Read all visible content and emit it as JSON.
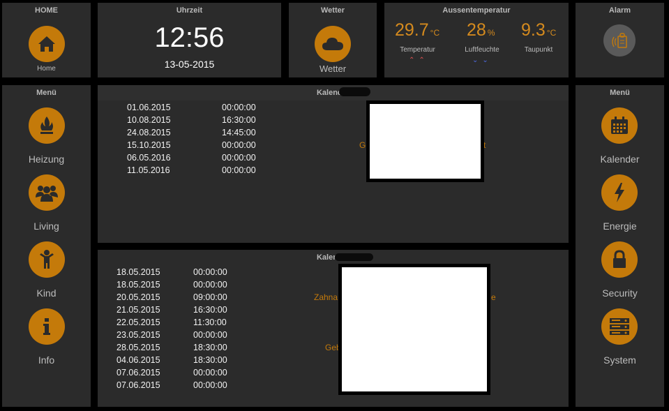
{
  "home": {
    "title": "HOME",
    "label": "Home",
    "icon": "home-icon"
  },
  "clock": {
    "title": "Uhrzeit",
    "time": "12:56",
    "date": "13-05-2015"
  },
  "weather": {
    "title": "Wetter",
    "label": "Wetter",
    "icon": "cloud-icon"
  },
  "outdoor": {
    "title": "Aussentemperatur",
    "temperature": {
      "value": "29.7",
      "unit": "°C",
      "label": "Temperatur",
      "trend": "up"
    },
    "humidity": {
      "value": "28",
      "unit": "%",
      "label": "Luftfeuchte",
      "trend": "down"
    },
    "dewpoint": {
      "value": "9.3",
      "unit": "°C",
      "label": "Taupunkt"
    }
  },
  "alarm": {
    "title": "Alarm",
    "icon": "alarm-panel-icon"
  },
  "left_menu": {
    "title": "Menü",
    "items": [
      {
        "label": "Heizung",
        "icon": "flame-icon"
      },
      {
        "label": "Living",
        "icon": "people-icon"
      },
      {
        "label": "Kind",
        "icon": "child-icon"
      },
      {
        "label": "Info",
        "icon": "info-icon"
      }
    ]
  },
  "right_menu": {
    "title": "Menü",
    "items": [
      {
        "label": "Kalender",
        "icon": "calendar-icon"
      },
      {
        "label": "Energie",
        "icon": "lightning-icon"
      },
      {
        "label": "Security",
        "icon": "lock-icon"
      },
      {
        "label": "System",
        "icon": "server-icon"
      }
    ]
  },
  "calendar1": {
    "title": "Kalender",
    "rows": [
      {
        "date": "01.06.2015",
        "time": "00:00:00"
      },
      {
        "date": "10.08.2015",
        "time": "16:30:00"
      },
      {
        "date": "24.08.2015",
        "time": "14:45:00"
      },
      {
        "date": "15.10.2015",
        "time": "00:00:00"
      },
      {
        "date": "06.05.2016",
        "time": "00:00:00"
      },
      {
        "date": "11.05.2016",
        "time": "00:00:00"
      }
    ],
    "partial_left": "G",
    "partial_right": "t"
  },
  "calendar2": {
    "title": "Kalender",
    "rows": [
      {
        "date": "18.05.2015",
        "time": "00:00:00"
      },
      {
        "date": "18.05.2015",
        "time": "00:00:00"
      },
      {
        "date": "20.05.2015",
        "time": "09:00:00"
      },
      {
        "date": "21.05.2015",
        "time": "16:30:00"
      },
      {
        "date": "22.05.2015",
        "time": "11:30:00"
      },
      {
        "date": "23.05.2015",
        "time": "00:00:00"
      },
      {
        "date": "28.05.2015",
        "time": "18:30:00"
      },
      {
        "date": "04.06.2015",
        "time": "18:30:00"
      },
      {
        "date": "07.06.2015",
        "time": "00:00:00"
      },
      {
        "date": "07.06.2015",
        "time": "00:00:00"
      }
    ],
    "partial_1": "Zahna",
    "partial_2": "e",
    "partial_3": "Geb"
  },
  "colors": {
    "accent": "#c47a0a",
    "panel": "#2b2b2b",
    "background": "#000000"
  }
}
